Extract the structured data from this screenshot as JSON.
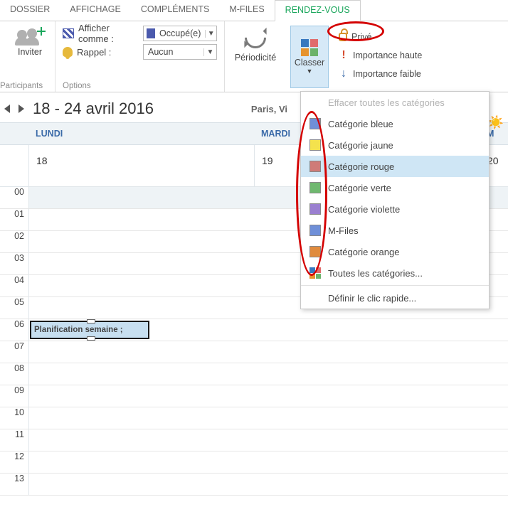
{
  "tabs": [
    "DOSSIER",
    "AFFICHAGE",
    "COMPLÉMENTS",
    "M-FILES",
    "RENDEZ-VOUS"
  ],
  "activeTab": 4,
  "ribbon": {
    "inviter": "Inviter",
    "participantsGroup": "Participants",
    "optionsGroup": "Options",
    "showAsLabel": "Afficher comme :",
    "showAsValue": "Occupé(e)",
    "reminderLabel": "Rappel :",
    "reminderValue": "Aucun",
    "recurrence": "Périodicité",
    "classify": "Classer",
    "private": "Privé",
    "highImportance": "Importance haute",
    "lowImportance": "Importance faible"
  },
  "dateRange": "18 - 24 avril 2016",
  "city": "Paris, Vi",
  "days": {
    "mon": {
      "label": "LUNDI",
      "num": "18"
    },
    "tue": {
      "label": "MARDI",
      "num": "19"
    },
    "wedNum": "20"
  },
  "hours": [
    "00",
    "01",
    "02",
    "03",
    "04",
    "05",
    "06",
    "07",
    "08",
    "09",
    "10",
    "11",
    "12",
    "13"
  ],
  "appointment": "Planification semaine ;",
  "menu": {
    "clear": "Effacer toutes les catégories",
    "items": [
      {
        "label": "Catégorie bleue",
        "color": "#6f8fd8"
      },
      {
        "label": "Catégorie jaune",
        "color": "#f4e24d"
      },
      {
        "label": "Catégorie rouge",
        "color": "#cf7b78"
      },
      {
        "label": "Catégorie verte",
        "color": "#6fb86f"
      },
      {
        "label": "Catégorie violette",
        "color": "#9a7fd0"
      },
      {
        "label": "M-Files",
        "color": "#6f8fd8"
      },
      {
        "label": "Catégorie orange",
        "color": "#e08b3e"
      }
    ],
    "all": "Toutes les catégories...",
    "quick": "Définir le clic rapide...",
    "hoverIndex": 2
  },
  "colors": {
    "busy": "#4b5aad"
  }
}
